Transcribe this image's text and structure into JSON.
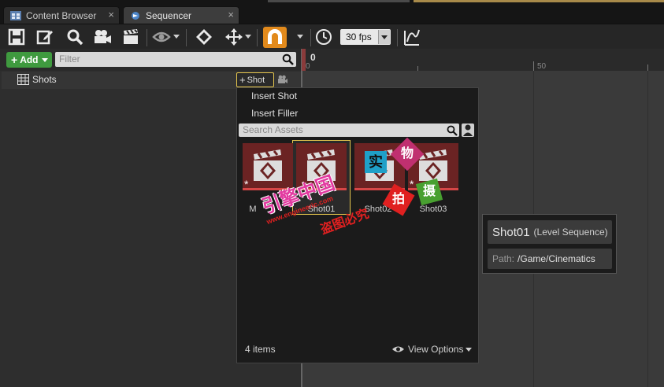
{
  "tabs": [
    {
      "label": "Content Browser",
      "icon": "content-browser-icon"
    },
    {
      "label": "Sequencer",
      "icon": "sequencer-icon",
      "active": true
    }
  ],
  "tab_close_glyph": "×",
  "toolbar": {
    "fps_value": "30 fps",
    "icons": [
      "save-icon",
      "edit-icon",
      "search-icon",
      "camera-icon",
      "clapper-icon",
      "eye-icon",
      "key-icon",
      "transform-icon",
      "magnet-icon",
      "clock-icon",
      "curve-icon"
    ],
    "accent": "#e28a1c"
  },
  "left": {
    "add_label": "Add",
    "filter_placeholder": "Filter",
    "track_label": "Shots",
    "shot_button_label": "Shot"
  },
  "timeline": {
    "current_frame": "0",
    "ruler_labels": [
      "0",
      "50"
    ]
  },
  "menu": {
    "items": [
      "Insert Shot",
      "Insert Filler"
    ],
    "search_placeholder": "Search Assets",
    "assets": [
      {
        "label": "M"
      },
      {
        "label": "Shot01",
        "selected": true
      },
      {
        "label": "Shot02"
      },
      {
        "label": "Shot03"
      }
    ],
    "count_label": "4 items",
    "view_options_label": "View Options"
  },
  "tooltip": {
    "name": "Shot01",
    "type": "(Level Sequence)",
    "path_label": "Path:",
    "path_value": "/Game/Cinematics"
  },
  "watermark": {
    "line1": "引擎中国",
    "line2": "www.engineeric.com",
    "line3": "盗图必究",
    "stamps": [
      "实",
      "物",
      "拍",
      "摄"
    ],
    "colors": {
      "magenta": "#e23aa0",
      "red": "#e02020",
      "blue": "#1fa0c8",
      "green": "#48a030",
      "pink": "#c03070"
    }
  }
}
